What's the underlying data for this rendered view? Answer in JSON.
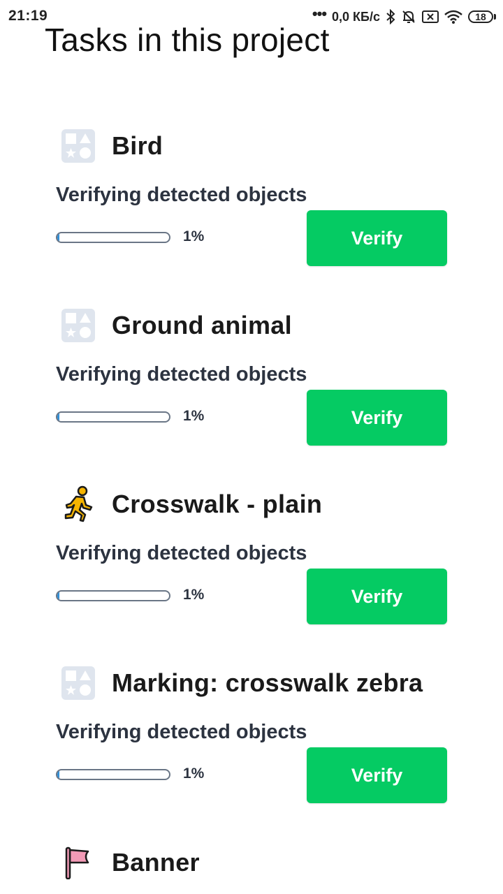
{
  "status_bar": {
    "time": "21:19",
    "dots": "•••",
    "speed": "0,0 КБ/с",
    "battery": "18",
    "icons": [
      "bluetooth-icon",
      "bell-off-icon",
      "sim-x-icon",
      "wifi-icon",
      "battery-icon"
    ]
  },
  "page": {
    "title": "Tasks in this project"
  },
  "tasks": [
    {
      "name": "Bird",
      "icon": "placeholder-shapes-icon",
      "status": "Verifying detected objects",
      "progress_label": "1%",
      "progress": 0.01,
      "button": "Verify"
    },
    {
      "name": "Ground animal",
      "icon": "placeholder-shapes-icon",
      "status": "Verifying detected objects",
      "progress_label": "1%",
      "progress": 0.01,
      "button": "Verify"
    },
    {
      "name": "Crosswalk - plain",
      "icon": "pedestrian-icon",
      "status": "Verifying detected objects",
      "progress_label": "1%",
      "progress": 0.01,
      "button": "Verify"
    },
    {
      "name": "Marking: crosswalk zebra",
      "icon": "placeholder-shapes-icon",
      "status": "Verifying detected objects",
      "progress_label": "1%",
      "progress": 0.01,
      "button": "Verify"
    },
    {
      "name": "Banner",
      "icon": "flag-icon"
    }
  ],
  "colors": {
    "verify_button": "#05cb63",
    "progress_fill": "#2f8fd8",
    "placeholder_icon": "#dfe5ee",
    "pedestrian_icon": "#f5b400",
    "flag_icon": "#f29ab6"
  }
}
